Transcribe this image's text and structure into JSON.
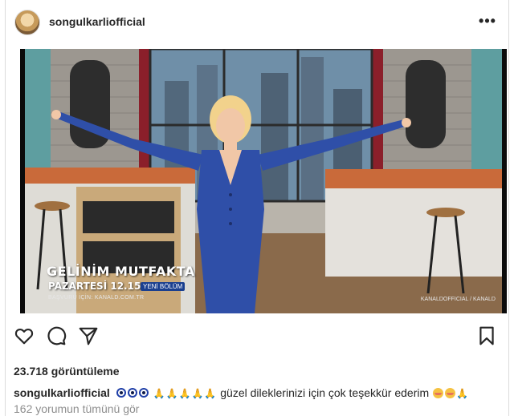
{
  "post": {
    "username": "songulkarliofficial",
    "more_label": "•••"
  },
  "video": {
    "overlay_title": "GELİNİM MUTFAKTA",
    "overlay_time": "PAZARTESİ 12.15",
    "overlay_badge": "YENİ BÖLÜM",
    "overlay_url": "BAŞVURU İÇİN: KANALD.COM.TR",
    "overlay_social": "KANALDOFFICIAL / KANALD"
  },
  "actions": {
    "like_icon": "heart-icon",
    "comment_icon": "comment-icon",
    "share_icon": "share-icon",
    "save_icon": "bookmark-icon"
  },
  "stats": {
    "views": "23.718 görüntüleme"
  },
  "caption": {
    "username": "songulkarliofficial",
    "text": "güzel dileklerinizi için çok teşekkür ederim"
  },
  "comments": {
    "view_all": "162 yorumun tümünü gör"
  },
  "colors": {
    "text": "#262626",
    "muted": "#8e8e8e",
    "dress": "#2f4fa8"
  }
}
